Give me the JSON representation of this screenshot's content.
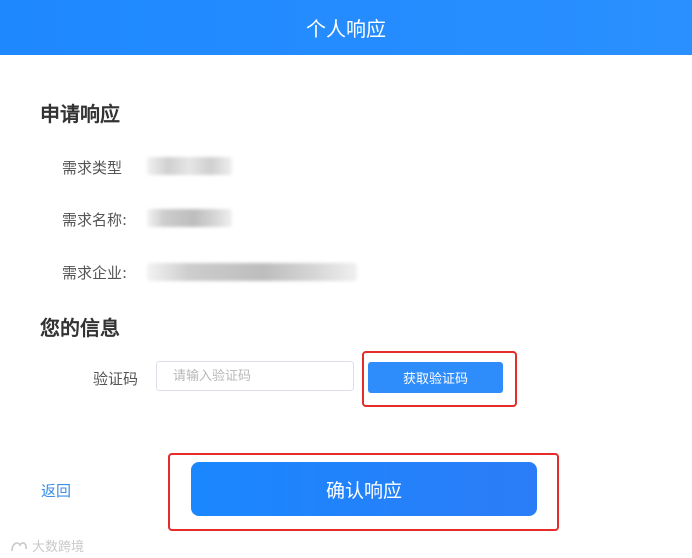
{
  "header": {
    "title": "个人响应"
  },
  "apply_section": {
    "title": "申请响应",
    "fields": [
      {
        "label": "需求类型"
      },
      {
        "label": "需求名称:"
      },
      {
        "label": "需求企业:"
      }
    ]
  },
  "info_section": {
    "title": "您的信息",
    "code_label": "验证码",
    "code_placeholder": "请输入验证码",
    "code_value": "",
    "get_code_label": "获取验证码"
  },
  "footer": {
    "back_label": "返回",
    "confirm_label": "确认响应"
  },
  "watermark": {
    "text": "大数跨境"
  },
  "colors": {
    "primary": "#2a90ff",
    "highlight_outline": "#e62b2b",
    "link": "#3a8ee6"
  }
}
